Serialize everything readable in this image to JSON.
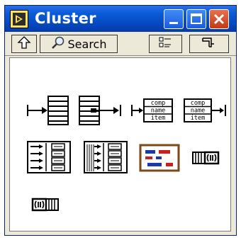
{
  "window": {
    "title": "Cluster",
    "colors": {
      "titlebar": "#0648c0",
      "close_button": "#c23a16",
      "frame": "#ece9d8"
    }
  },
  "toolbar": {
    "up_icon": "up-arrow-icon",
    "search_label": "Search",
    "search_icon": "magnifier-icon",
    "view_icon": "view-options-icon",
    "pin_icon": "pin-icon"
  },
  "palette": {
    "items": [
      {
        "name": "bundle-node",
        "labels": []
      },
      {
        "name": "unbundle-node",
        "labels": []
      },
      {
        "name": "bundle-by-name-node",
        "labels": [
          "comp",
          "name",
          "item"
        ]
      },
      {
        "name": "unbundle-by-name-node",
        "labels": [
          "comp",
          "name",
          "item"
        ]
      },
      {
        "name": "build-cluster-array-node",
        "labels": []
      },
      {
        "name": "index-and-bundle-cluster-array-node",
        "labels": []
      },
      {
        "name": "cluster-constant-node",
        "labels": []
      },
      {
        "name": "cluster-to-array-node",
        "labels": []
      },
      {
        "name": "array-to-cluster-node",
        "labels": []
      }
    ]
  }
}
